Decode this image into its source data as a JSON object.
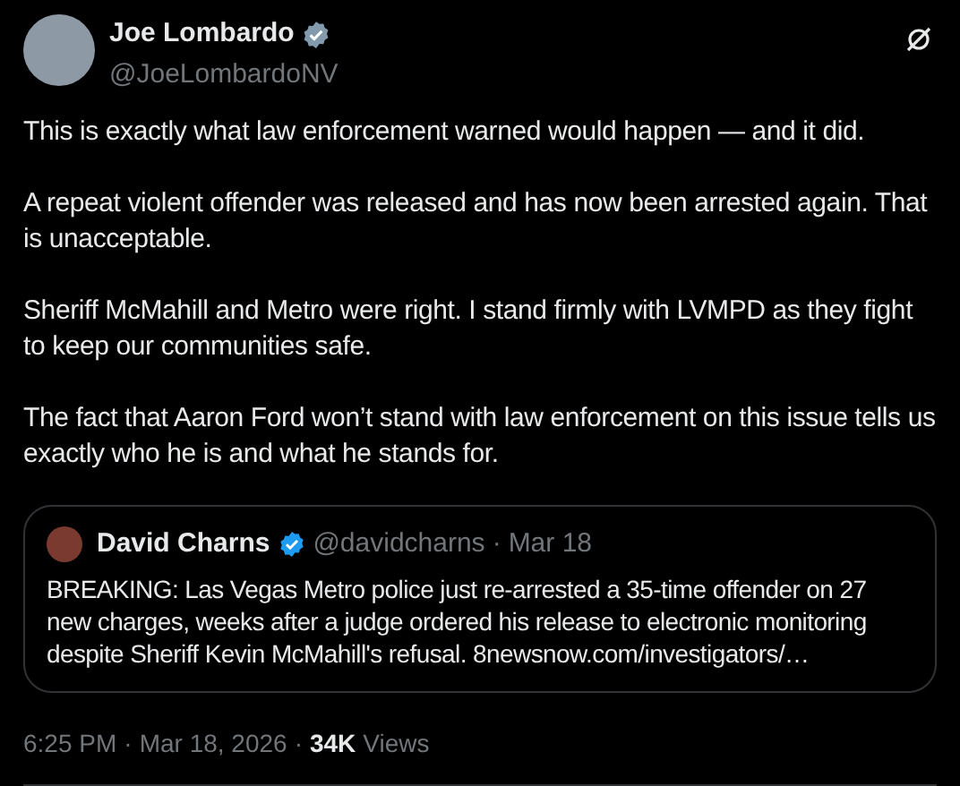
{
  "author": {
    "name": "Joe Lombardo",
    "handle": "@JoeLombardoNV",
    "badge": {
      "color": "#829aab"
    }
  },
  "body": [
    "This is exactly what law enforcement warned would happen — and it did.",
    "A repeat violent offender was released and has now been arrested again. That is unacceptable.",
    "Sheriff McMahill and Metro were right. I stand firmly with LVMPD as they fight to keep our communities safe.",
    "The fact that Aaron Ford won’t stand with law enforcement on this issue tells us exactly who he is and what he stands for."
  ],
  "quote": {
    "name": "David Charns",
    "badge": {
      "color": "#1d9bf0"
    },
    "handle": "@davidcharns",
    "separator": "·",
    "date": "Mar 18",
    "text": "BREAKING: Las Vegas Metro police just re-arrested a 35-time offender on 27 new charges, weeks after a judge ordered his release to electronic monitoring despite Sheriff Kevin McMahill's refusal.",
    "link": "8newsnow.com/investigators/…"
  },
  "footer": {
    "time": "6:25 PM",
    "separator_1": "·",
    "date": "Mar 18, 2026",
    "separator_2": "·",
    "views_count": "34K",
    "views_label": "Views"
  }
}
